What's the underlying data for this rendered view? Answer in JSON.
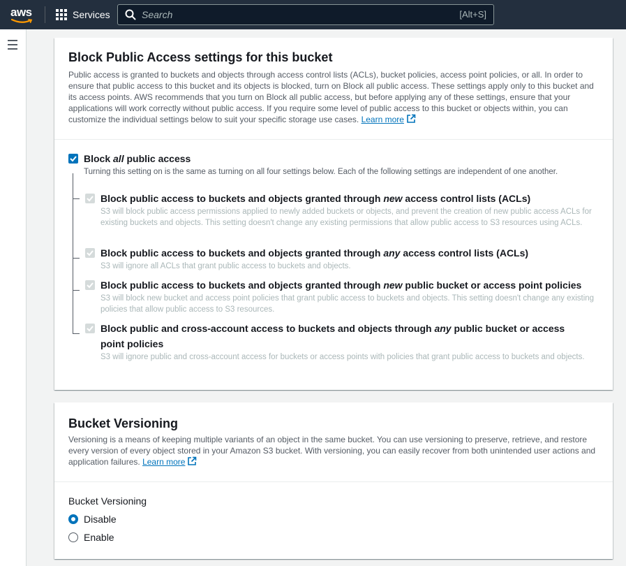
{
  "nav": {
    "logo": "aws",
    "services_label": "Services",
    "search_placeholder": "Search",
    "search_shortcut": "[Alt+S]"
  },
  "block_public_access": {
    "title": "Block Public Access settings for this bucket",
    "description": "Public access is granted to buckets and objects through access control lists (ACLs), bucket policies, access point policies, or all. In order to ensure that public access to this bucket and its objects is blocked, turn on Block all public access. These settings apply only to this bucket and its access points. AWS recommends that you turn on Block all public access, but before applying any of these settings, ensure that your applications will work correctly without public access. If you require some level of public access to this bucket or objects within, you can customize the individual settings below to suit your specific storage use cases.",
    "learn_more": "Learn more",
    "block_all": {
      "label_before": "Block ",
      "label_em": "all",
      "label_after": " public access",
      "checked": true,
      "description": "Turning this setting on is the same as turning on all four settings below. Each of the following settings are independent of one another."
    },
    "options": [
      {
        "label_before": "Block public access to buckets and objects granted through ",
        "label_em": "new",
        "label_after": " access control lists (ACLs)",
        "description": "S3 will block public access permissions applied to newly added buckets or objects, and prevent the creation of new public access ACLs for existing buckets and objects. This setting doesn't change any existing permissions that allow public access to S3 resources using ACLs.",
        "checked": true,
        "disabled": true
      },
      {
        "label_before": "Block public access to buckets and objects granted through ",
        "label_em": "any",
        "label_after": " access control lists (ACLs)",
        "description": "S3 will ignore all ACLs that grant public access to buckets and objects.",
        "checked": true,
        "disabled": true
      },
      {
        "label_before": "Block public access to buckets and objects granted through ",
        "label_em": "new",
        "label_after": " public bucket or access point policies",
        "description": "S3 will block new bucket and access point policies that grant public access to buckets and objects. This setting doesn't change any existing policies that allow public access to S3 resources.",
        "checked": true,
        "disabled": true
      },
      {
        "label_before": "Block public and cross-account access to buckets and objects through ",
        "label_em": "any",
        "label_after": " public bucket or access point policies",
        "description": "S3 will ignore public and cross-account access for buckets or access points with policies that grant public access to buckets and objects.",
        "checked": true,
        "disabled": true
      }
    ]
  },
  "versioning": {
    "title": "Bucket Versioning",
    "description": "Versioning is a means of keeping multiple variants of an object in the same bucket. You can use versioning to preserve, retrieve, and restore every version of every object stored in your Amazon S3 bucket. With versioning, you can easily recover from both unintended user actions and application failures.",
    "learn_more": "Learn more",
    "field_label": "Bucket Versioning",
    "options": [
      {
        "label": "Disable",
        "selected": true
      },
      {
        "label": "Enable",
        "selected": false
      }
    ]
  },
  "colors": {
    "nav_bg": "#232f3e",
    "accent": "#0073bb",
    "link": "#0073bb",
    "disabled": "#aab7b8"
  }
}
